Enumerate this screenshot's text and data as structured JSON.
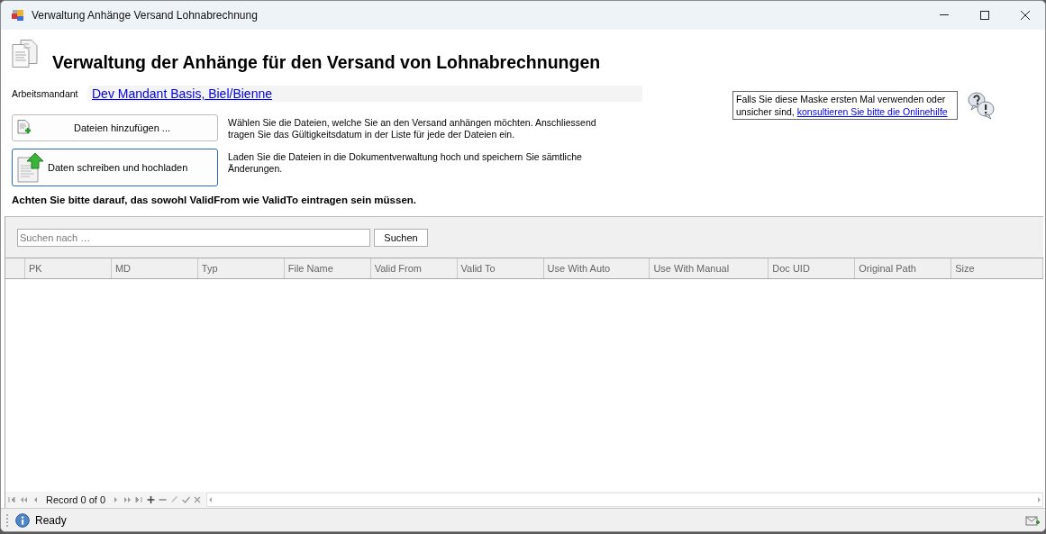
{
  "window": {
    "title": "Verwaltung Anhänge Versand Lohnabrechnung"
  },
  "heading": "Verwaltung der Anhänge für den Versand von Lohnabrechnungen",
  "mandant": {
    "label": "Arbeitsmandant",
    "value": "Dev Mandant Basis, Biel/Bienne"
  },
  "help": {
    "text": "Falls Sie diese Maske ersten Mal verwenden oder unsicher sind, ",
    "link": "konsultieren Sie bitte die Onlinehilfe"
  },
  "actions": [
    {
      "kind": "add",
      "label": "Dateien hinzufügen ...",
      "focused": false,
      "description": "Wählen Sie die Dateien, welche Sie an den Versand anhängen möchten. Anschliessend tragen Sie das Gültigkeitsdatum in der Liste für jede der Dateien ein."
    },
    {
      "kind": "upload",
      "label": "Daten schreiben und hochladen",
      "focused": true,
      "description": "Laden Sie die Dateien in die Dokumentverwaltung hoch und speichern Sie sämtliche Änderungen."
    }
  ],
  "warning": "Achten Sie bitte darauf, das sowohl ValidFrom wie ValidTo eintragen sein müssen.",
  "search": {
    "placeholder": "Suchen nach …",
    "button": "Suchen"
  },
  "table": {
    "columns": [
      "PK",
      "MD",
      "Typ",
      "File Name",
      "Valid From",
      "Valid To",
      "Use With Auto",
      "Use With Manual",
      "Doc UID",
      "Original Path",
      "Size"
    ]
  },
  "navigator": {
    "record": "Record 0 of 0"
  },
  "status_bar": {
    "text": "Ready"
  }
}
